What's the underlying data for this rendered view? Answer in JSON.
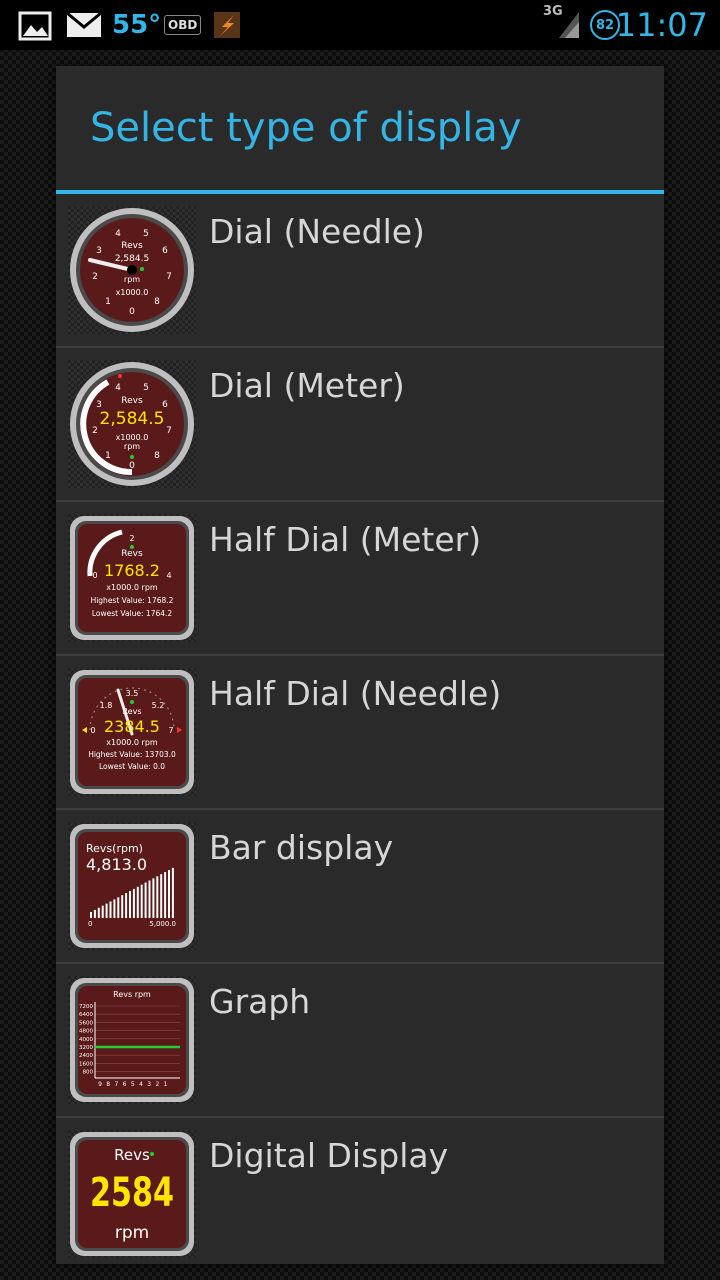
{
  "status_bar": {
    "icons": [
      "gallery-icon",
      "gmail-icon",
      "torque-icon",
      "signal-icon"
    ],
    "temperature": "55°",
    "obd": "OBD",
    "network": "3G",
    "battery": "82",
    "time": "11:07"
  },
  "dialog": {
    "title": "Select type of display",
    "items": [
      {
        "label": "Dial (Needle)",
        "thumb": {
          "title": "Revs",
          "value": "2,584.5",
          "unit": "rpm",
          "scale": "x1000.0",
          "ticks": [
            "0",
            "1",
            "2",
            "3",
            "4",
            "5",
            "6",
            "7",
            "8"
          ]
        }
      },
      {
        "label": "Dial (Meter)",
        "thumb": {
          "title": "Revs",
          "value": "2,584.5",
          "unit": "rpm",
          "scale": "x1000.0",
          "ticks": [
            "0",
            "1",
            "2",
            "3",
            "4",
            "5",
            "6",
            "7",
            "8"
          ]
        }
      },
      {
        "label": "Half Dial (Meter)",
        "thumb": {
          "title": "Revs",
          "value": "1768.2",
          "unit": "x1000.0 rpm",
          "highest": "Highest Value: 1768.2",
          "lowest": "Lowest Value: 1764.2",
          "ticks": [
            "0",
            "2",
            "4"
          ]
        }
      },
      {
        "label": "Half Dial (Needle)",
        "thumb": {
          "title": "Revs",
          "value": "2384.5",
          "unit": "x1000.0 rpm",
          "highest": "Highest Value: 13703.0",
          "lowest": "Lowest Value: 0.0",
          "ticks": [
            "0",
            "1.8",
            "3.5",
            "5.2",
            "7"
          ]
        }
      },
      {
        "label": "Bar display",
        "thumb": {
          "title": "Revs(rpm)",
          "value": "4,813.0",
          "min": "0",
          "max": "5,000.0"
        }
      },
      {
        "label": "Graph",
        "thumb": {
          "title": "Revs rpm",
          "yticks": [
            "7200",
            "6400",
            "5600",
            "4800",
            "4000",
            "3200",
            "2400",
            "1600",
            "800"
          ],
          "xticks": [
            "9",
            "8",
            "7",
            "6",
            "5",
            "4",
            "3",
            "2",
            "1"
          ]
        }
      },
      {
        "label": "Digital Display",
        "thumb": {
          "title": "Revs",
          "value": "2584",
          "unit": "rpm"
        }
      }
    ]
  }
}
